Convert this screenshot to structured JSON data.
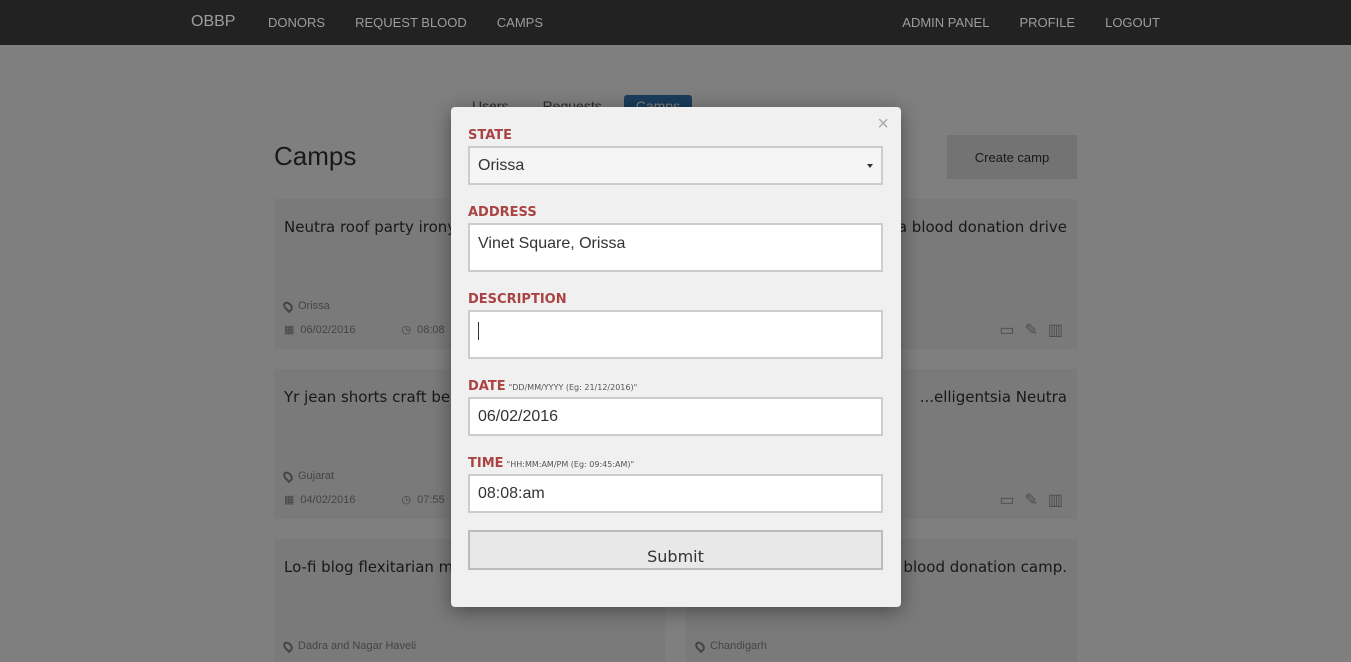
{
  "navbar": {
    "brand": "OBBP",
    "left_links": [
      "DONORS",
      "REQUEST BLOOD",
      "CAMPS"
    ],
    "right_links": [
      "ADMIN PANEL",
      "PROFILE",
      "LOGOUT"
    ]
  },
  "tabs": [
    "Users",
    "Requests",
    "Camps"
  ],
  "page": {
    "title": "Camps",
    "create_button": "Create camp"
  },
  "cards": [
    {
      "text": "Neutra roof party irony Thundercats.",
      "state": "Orissa",
      "date": "06/02/2016",
      "time": "08:08"
    },
    {
      "text": "...g a blood donation drive",
      "state": "",
      "date": "",
      "time": ""
    },
    {
      "text": "Yr jean shorts craft beer",
      "state": "Gujarat",
      "date": "04/02/2016",
      "time": "07:55"
    },
    {
      "text": "...elligentsia Neutra",
      "state": "",
      "date": "",
      "time": ""
    },
    {
      "text": "Lo-fi blog flexitarian mu... Vice viral hoodie.",
      "state": "Dadra and Nagar Haveli",
      "date": "",
      "time": ""
    },
    {
      "text": "...a blood donation camp.",
      "state": "Chandigarh",
      "date": "",
      "time": ""
    }
  ],
  "modal": {
    "close": "×",
    "state_label": "STATE",
    "state_value": "Orissa",
    "address_label": "ADDRESS",
    "address_value": "Vinet Square, Orissa",
    "description_label": "DESCRIPTION",
    "description_value": "",
    "date_label": "DATE",
    "date_hint": "\"DD/MM/YYYY (Eg: 21/12/2016)\"",
    "date_value": "06/02/2016",
    "time_label": "TIME",
    "time_hint": "\"HH:MM:AM/PM (Eg: 09:45:AM)\"",
    "time_value": "08:08:am",
    "submit": "Submit"
  },
  "colors": {
    "navbar": "#222222",
    "label": "#a94442",
    "active_tab": "#337ab7"
  }
}
